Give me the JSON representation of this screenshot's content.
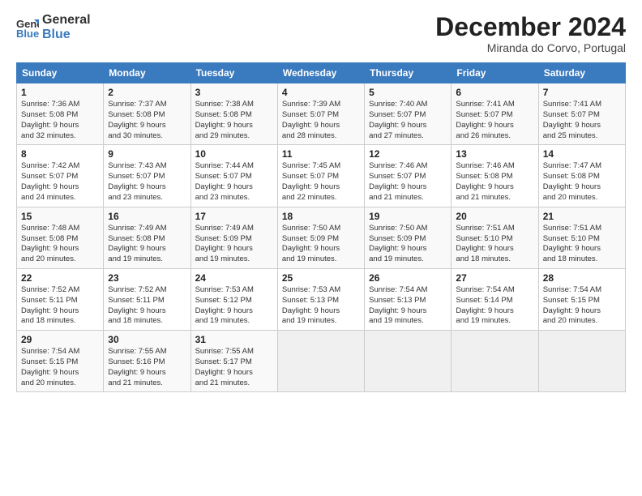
{
  "logo": {
    "line1": "General",
    "line2": "Blue"
  },
  "title": "December 2024",
  "location": "Miranda do Corvo, Portugal",
  "headers": [
    "Sunday",
    "Monday",
    "Tuesday",
    "Wednesday",
    "Thursday",
    "Friday",
    "Saturday"
  ],
  "weeks": [
    [
      {
        "day": "1",
        "info": "Sunrise: 7:36 AM\nSunset: 5:08 PM\nDaylight: 9 hours\nand 32 minutes."
      },
      {
        "day": "2",
        "info": "Sunrise: 7:37 AM\nSunset: 5:08 PM\nDaylight: 9 hours\nand 30 minutes."
      },
      {
        "day": "3",
        "info": "Sunrise: 7:38 AM\nSunset: 5:08 PM\nDaylight: 9 hours\nand 29 minutes."
      },
      {
        "day": "4",
        "info": "Sunrise: 7:39 AM\nSunset: 5:07 PM\nDaylight: 9 hours\nand 28 minutes."
      },
      {
        "day": "5",
        "info": "Sunrise: 7:40 AM\nSunset: 5:07 PM\nDaylight: 9 hours\nand 27 minutes."
      },
      {
        "day": "6",
        "info": "Sunrise: 7:41 AM\nSunset: 5:07 PM\nDaylight: 9 hours\nand 26 minutes."
      },
      {
        "day": "7",
        "info": "Sunrise: 7:41 AM\nSunset: 5:07 PM\nDaylight: 9 hours\nand 25 minutes."
      }
    ],
    [
      {
        "day": "8",
        "info": "Sunrise: 7:42 AM\nSunset: 5:07 PM\nDaylight: 9 hours\nand 24 minutes."
      },
      {
        "day": "9",
        "info": "Sunrise: 7:43 AM\nSunset: 5:07 PM\nDaylight: 9 hours\nand 23 minutes."
      },
      {
        "day": "10",
        "info": "Sunrise: 7:44 AM\nSunset: 5:07 PM\nDaylight: 9 hours\nand 23 minutes."
      },
      {
        "day": "11",
        "info": "Sunrise: 7:45 AM\nSunset: 5:07 PM\nDaylight: 9 hours\nand 22 minutes."
      },
      {
        "day": "12",
        "info": "Sunrise: 7:46 AM\nSunset: 5:07 PM\nDaylight: 9 hours\nand 21 minutes."
      },
      {
        "day": "13",
        "info": "Sunrise: 7:46 AM\nSunset: 5:08 PM\nDaylight: 9 hours\nand 21 minutes."
      },
      {
        "day": "14",
        "info": "Sunrise: 7:47 AM\nSunset: 5:08 PM\nDaylight: 9 hours\nand 20 minutes."
      }
    ],
    [
      {
        "day": "15",
        "info": "Sunrise: 7:48 AM\nSunset: 5:08 PM\nDaylight: 9 hours\nand 20 minutes."
      },
      {
        "day": "16",
        "info": "Sunrise: 7:49 AM\nSunset: 5:08 PM\nDaylight: 9 hours\nand 19 minutes."
      },
      {
        "day": "17",
        "info": "Sunrise: 7:49 AM\nSunset: 5:09 PM\nDaylight: 9 hours\nand 19 minutes."
      },
      {
        "day": "18",
        "info": "Sunrise: 7:50 AM\nSunset: 5:09 PM\nDaylight: 9 hours\nand 19 minutes."
      },
      {
        "day": "19",
        "info": "Sunrise: 7:50 AM\nSunset: 5:09 PM\nDaylight: 9 hours\nand 19 minutes."
      },
      {
        "day": "20",
        "info": "Sunrise: 7:51 AM\nSunset: 5:10 PM\nDaylight: 9 hours\nand 18 minutes."
      },
      {
        "day": "21",
        "info": "Sunrise: 7:51 AM\nSunset: 5:10 PM\nDaylight: 9 hours\nand 18 minutes."
      }
    ],
    [
      {
        "day": "22",
        "info": "Sunrise: 7:52 AM\nSunset: 5:11 PM\nDaylight: 9 hours\nand 18 minutes."
      },
      {
        "day": "23",
        "info": "Sunrise: 7:52 AM\nSunset: 5:11 PM\nDaylight: 9 hours\nand 18 minutes."
      },
      {
        "day": "24",
        "info": "Sunrise: 7:53 AM\nSunset: 5:12 PM\nDaylight: 9 hours\nand 19 minutes."
      },
      {
        "day": "25",
        "info": "Sunrise: 7:53 AM\nSunset: 5:13 PM\nDaylight: 9 hours\nand 19 minutes."
      },
      {
        "day": "26",
        "info": "Sunrise: 7:54 AM\nSunset: 5:13 PM\nDaylight: 9 hours\nand 19 minutes."
      },
      {
        "day": "27",
        "info": "Sunrise: 7:54 AM\nSunset: 5:14 PM\nDaylight: 9 hours\nand 19 minutes."
      },
      {
        "day": "28",
        "info": "Sunrise: 7:54 AM\nSunset: 5:15 PM\nDaylight: 9 hours\nand 20 minutes."
      }
    ],
    [
      {
        "day": "29",
        "info": "Sunrise: 7:54 AM\nSunset: 5:15 PM\nDaylight: 9 hours\nand 20 minutes."
      },
      {
        "day": "30",
        "info": "Sunrise: 7:55 AM\nSunset: 5:16 PM\nDaylight: 9 hours\nand 21 minutes."
      },
      {
        "day": "31",
        "info": "Sunrise: 7:55 AM\nSunset: 5:17 PM\nDaylight: 9 hours\nand 21 minutes."
      },
      null,
      null,
      null,
      null
    ]
  ]
}
